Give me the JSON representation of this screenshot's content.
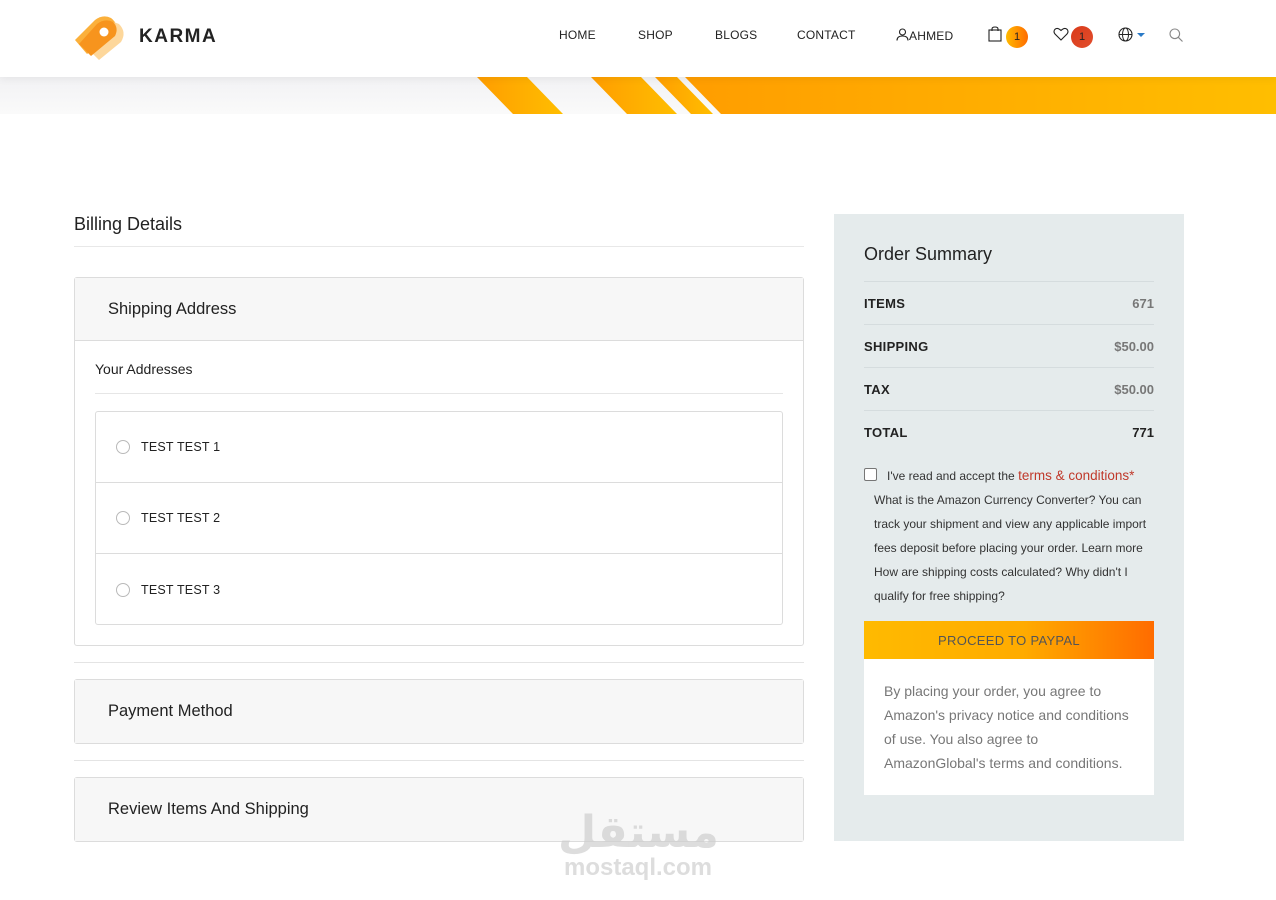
{
  "brand": {
    "name": "KARMA"
  },
  "nav": {
    "home": "HOME",
    "shop": "SHOP",
    "blogs": "BLOGS",
    "contact": "CONTACT",
    "user": "AHMED",
    "cart_count": "1",
    "wishlist_count": "1"
  },
  "billing": {
    "title": "Billing Details",
    "shipping_address": {
      "title": "Shipping Address",
      "subtitle": "Your Addresses",
      "addresses": [
        {
          "label": "TEST TEST 1"
        },
        {
          "label": "TEST TEST 2"
        },
        {
          "label": "TEST TEST 3"
        }
      ]
    },
    "payment_method": {
      "title": "Payment Method"
    },
    "review": {
      "title": "Review Items And Shipping"
    }
  },
  "summary": {
    "title": "Order Summary",
    "rows": [
      {
        "key": "ITEMS",
        "value": "671"
      },
      {
        "key": "SHIPPING",
        "value": "$50.00"
      },
      {
        "key": "TAX",
        "value": "$50.00"
      },
      {
        "key": "TOTAL",
        "value": "771"
      }
    ],
    "terms_prefix": "I've read and accept the",
    "terms_link": "terms & conditions*",
    "terms_body": "What is the Amazon Currency Converter? You can track your shipment and view any applicable import fees deposit before placing your order. Learn more How are shipping costs calculated? Why didn't I qualify for free shipping?",
    "paypal_label": "PROCEED TO PAYPAL",
    "notice": "By placing your order, you agree to Amazon's privacy notice and conditions of use. You also agree to AmazonGlobal's terms and conditions."
  },
  "watermark": {
    "arabic": "مستقل",
    "latin": "mostaql.com"
  },
  "colors": {
    "accent_start": "#ffba00",
    "accent_end": "#ff6c00",
    "summary_bg": "#e5ebec",
    "link": "#c0392b"
  }
}
